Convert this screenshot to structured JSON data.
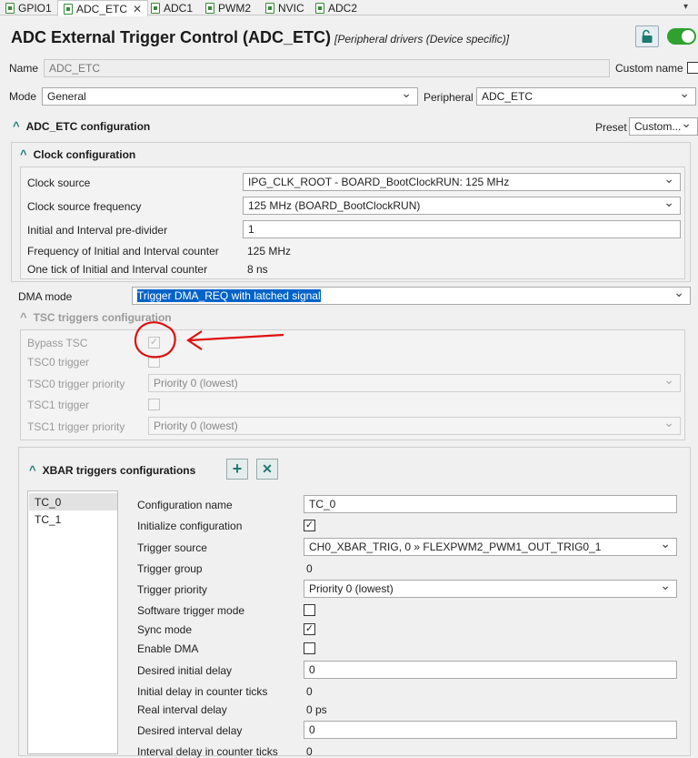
{
  "tabs": [
    {
      "label": "GPIO1"
    },
    {
      "label": "ADC_ETC",
      "close": "✕"
    },
    {
      "label": "ADC1"
    },
    {
      "label": "PWM2"
    },
    {
      "label": "NVIC"
    },
    {
      "label": "ADC2"
    }
  ],
  "tab_overflow": "▾",
  "header": {
    "title": "ADC External Trigger Control (ADC_ETC)",
    "subtitle": "[Peripheral drivers (Device specific)]"
  },
  "general": {
    "name_label": "Name",
    "name_value": "ADC_ETC",
    "custom_name_label": "Custom name",
    "mode_label": "Mode",
    "mode_value": "General",
    "peripheral_label": "Peripheral",
    "peripheral_value": "ADC_ETC"
  },
  "config": {
    "header": "ADC_ETC configuration",
    "preset_label": "Preset",
    "preset_value": "Custom..."
  },
  "clock": {
    "header": "Clock configuration",
    "rows": {
      "source": {
        "label": "Clock source",
        "value": "IPG_CLK_ROOT - BOARD_BootClockRUN: 125 MHz"
      },
      "freq": {
        "label": "Clock source frequency",
        "value": "125 MHz (BOARD_BootClockRUN)"
      },
      "prediv": {
        "label": "Initial and Interval pre-divider",
        "value": "1"
      },
      "counter_freq": {
        "label": "Frequency of Initial and Interval counter",
        "value": "125 MHz"
      },
      "tick": {
        "label": "One tick of Initial and Interval counter",
        "value": "8 ns"
      }
    }
  },
  "dma": {
    "label": "DMA mode",
    "value": "Trigger DMA_REQ with latched signal"
  },
  "tsc": {
    "header": "TSC triggers configuration",
    "bypass_label": "Bypass TSC",
    "tsc0_trigger_label": "TSC0 trigger",
    "tsc0_priority_label": "TSC0 trigger priority",
    "tsc0_priority_value": "Priority 0 (lowest)",
    "tsc1_trigger_label": "TSC1 trigger",
    "tsc1_priority_label": "TSC1 trigger priority",
    "tsc1_priority_value": "Priority 0 (lowest)"
  },
  "annotation_color": "#e01010",
  "xbar": {
    "header": "XBAR triggers configurations",
    "add_icon": "+",
    "remove_icon": "✕",
    "list": [
      "TC_0",
      "TC_1"
    ],
    "rows": {
      "config_name": {
        "label": "Configuration name",
        "value": "TC_0"
      },
      "init_config": {
        "label": "Initialize configuration"
      },
      "trigger_source": {
        "label": "Trigger source",
        "value": "CH0_XBAR_TRIG, 0 » FLEXPWM2_PWM1_OUT_TRIG0_1"
      },
      "trigger_group": {
        "label": "Trigger group",
        "value": "0"
      },
      "trigger_priority": {
        "label": "Trigger priority",
        "value": "Priority 0 (lowest)"
      },
      "software_trigger": {
        "label": "Software trigger mode"
      },
      "sync_mode": {
        "label": "Sync mode"
      },
      "enable_dma": {
        "label": "Enable DMA"
      },
      "desired_initial": {
        "label": "Desired initial delay",
        "value": "0"
      },
      "initial_ticks": {
        "label": "Initial delay in counter ticks",
        "value": "0"
      },
      "real_interval": {
        "label": "Real interval delay",
        "value": "0 ps"
      },
      "desired_interval": {
        "label": "Desired interval delay",
        "value": "0"
      },
      "interval_ticks": {
        "label": "Interval delay in counter ticks",
        "value": "0"
      }
    }
  }
}
